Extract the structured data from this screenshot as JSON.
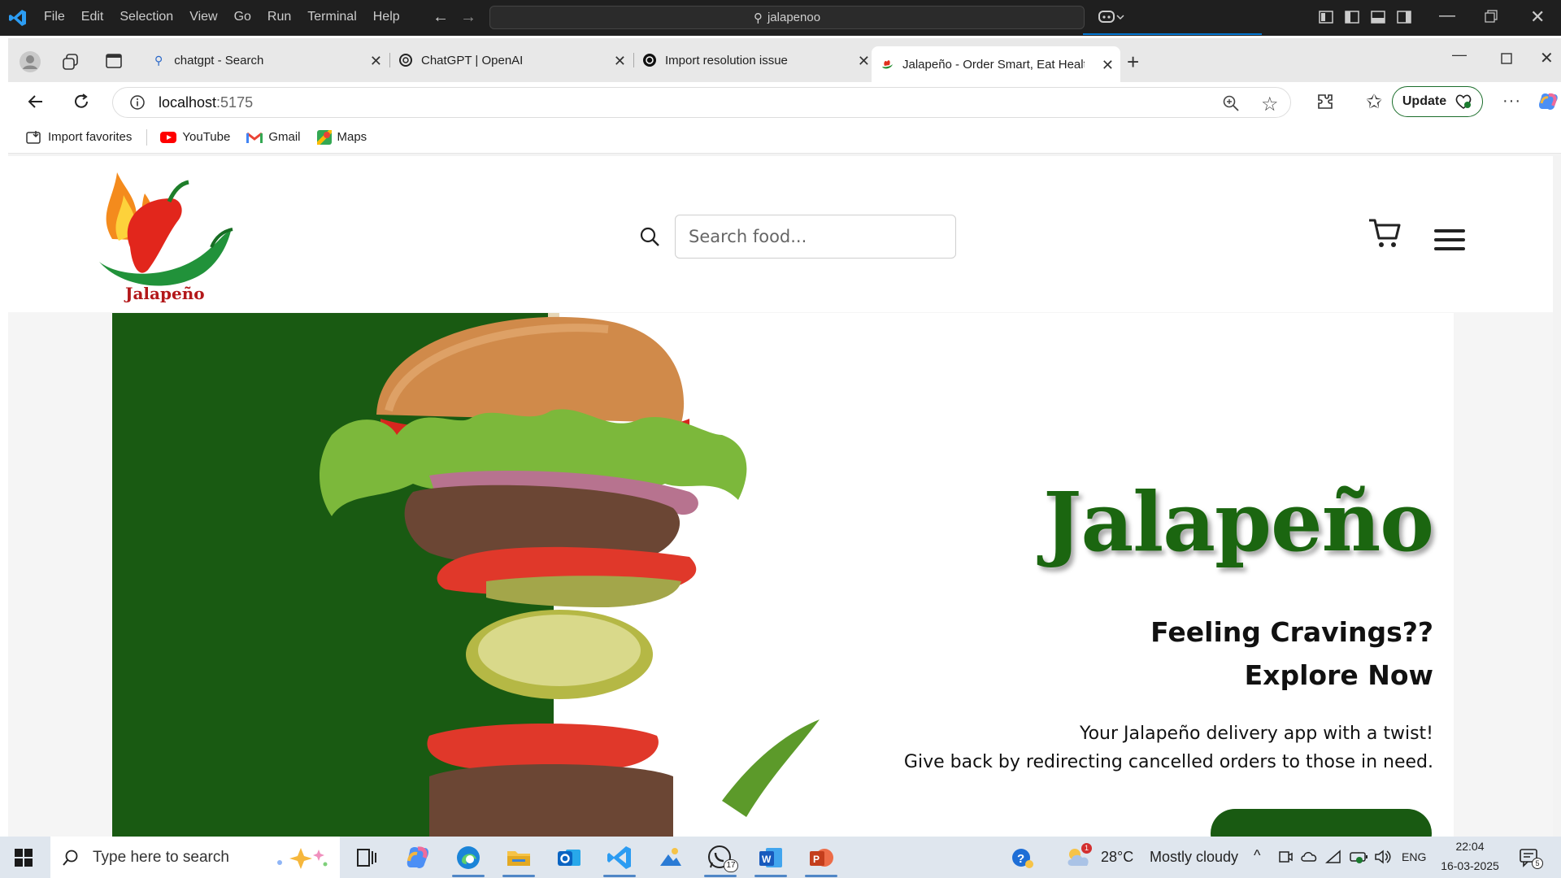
{
  "vscode": {
    "menu": [
      "File",
      "Edit",
      "Selection",
      "View",
      "Go",
      "Run",
      "Terminal",
      "Help"
    ],
    "command_center": "jalapenoo"
  },
  "browser": {
    "tabs": [
      {
        "label": "chatgpt - Search",
        "icon": "search-icon"
      },
      {
        "label": "ChatGPT | OpenAI",
        "icon": "openai-icon"
      },
      {
        "label": "Import resolution issue",
        "icon": "openai-icon"
      },
      {
        "label": "Jalapeño - Order Smart, Eat Healt",
        "icon": "jalapeno-favicon",
        "active": true
      }
    ],
    "url_host": "localhost",
    "url_port": ":5175",
    "update_label": "Update",
    "favorites": [
      {
        "label": "Import favorites",
        "icon": "import-icon"
      },
      {
        "label": "YouTube",
        "icon": "youtube-icon"
      },
      {
        "label": "Gmail",
        "icon": "gmail-icon"
      },
      {
        "label": "Maps",
        "icon": "maps-icon"
      }
    ]
  },
  "site": {
    "logo_text": "Jalapeño",
    "search_placeholder": "Search food...",
    "hero": {
      "brand": "Jalapeño",
      "cta_line1": "Feeling Cravings??",
      "cta_line2": "Explore Now",
      "tagline1": "Your Jalapeño delivery app with a twist!",
      "tagline2": "Give back by redirecting cancelled orders to those in need."
    },
    "colors": {
      "brand_green": "#1b6610",
      "hero_green": "#195a12"
    }
  },
  "taskbar": {
    "search_placeholder": "Type here to search",
    "weather_temp": "28°C",
    "weather_desc": "Mostly cloudy",
    "weather_badge": "1",
    "whatsapp_badge": "17",
    "language": "ENG",
    "time": "22:04",
    "date": "16-03-2025",
    "notifications": "5"
  }
}
